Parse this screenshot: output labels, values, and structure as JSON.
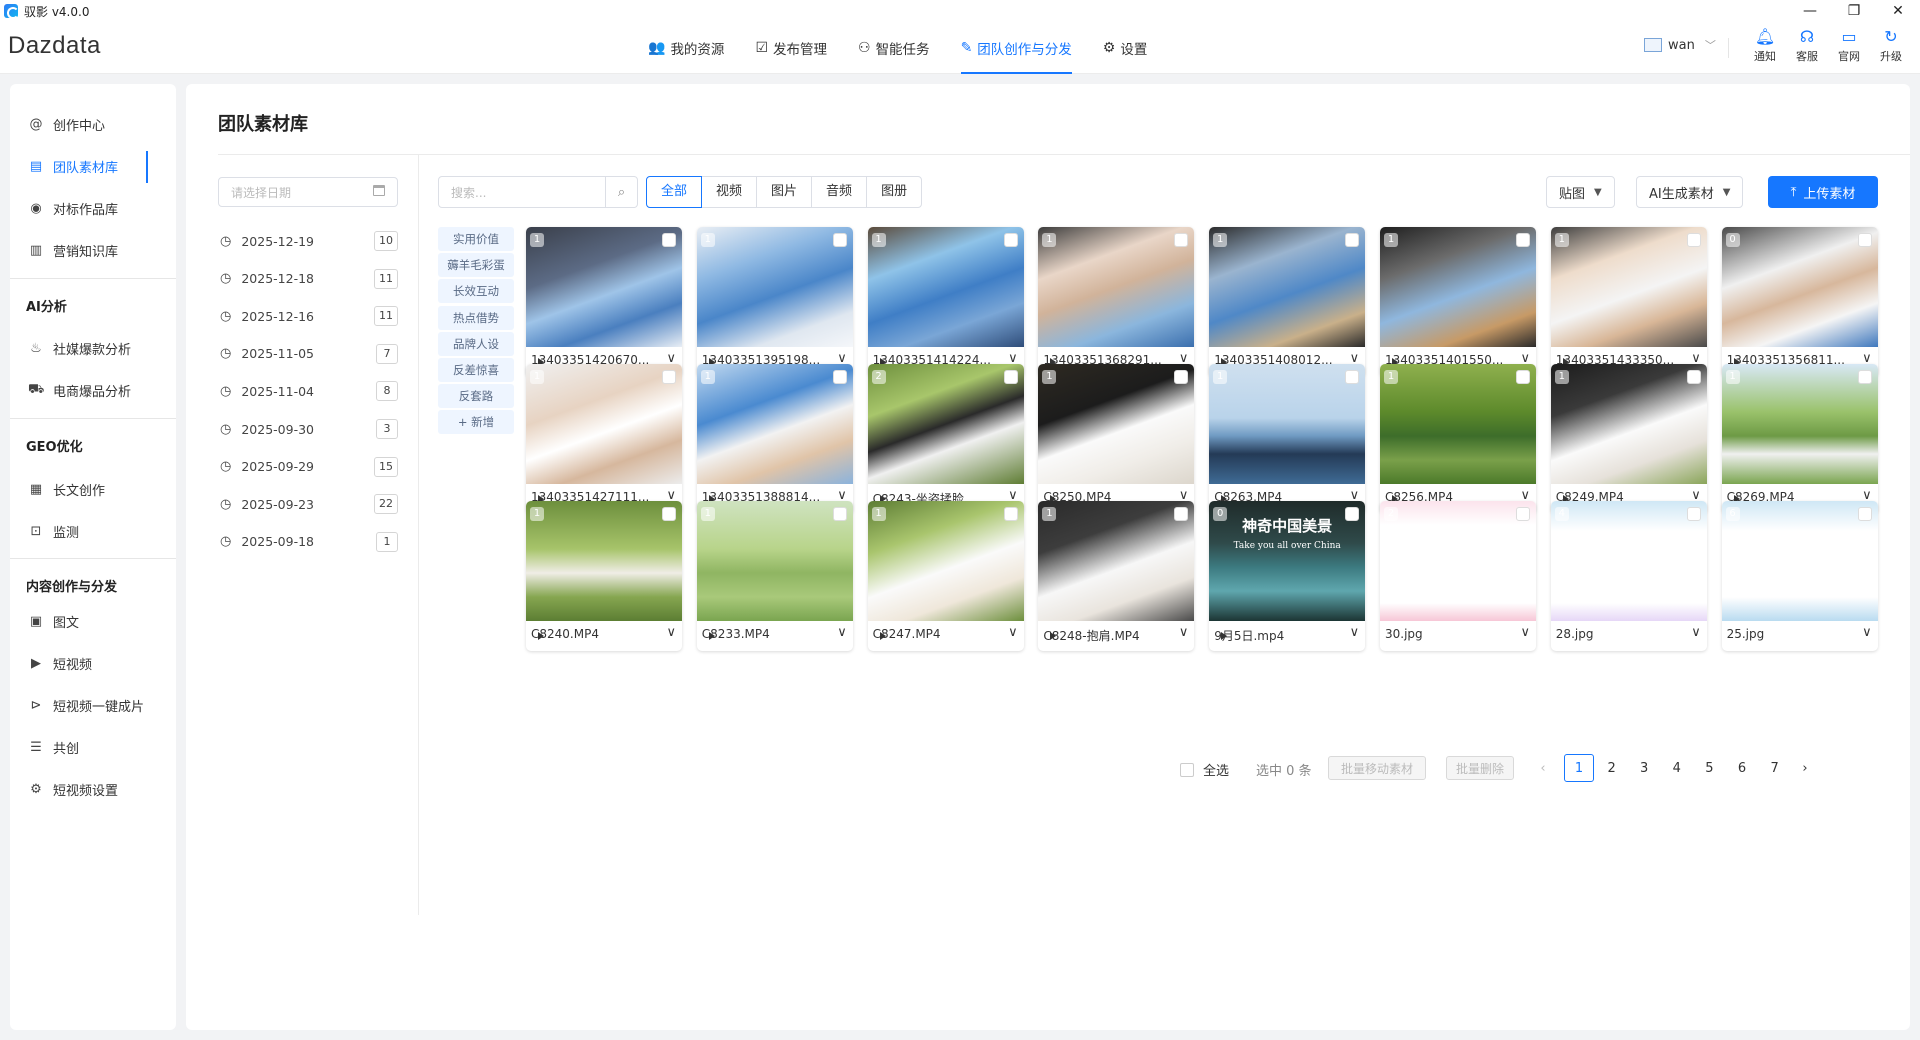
{
  "window": {
    "title": "驭影 v4.0.0",
    "controls": [
      "—",
      "❐",
      "✕"
    ]
  },
  "header": {
    "logo": "Dazdata",
    "nav": [
      {
        "label": "我的资源",
        "icon": "users-icon"
      },
      {
        "label": "发布管理",
        "icon": "publish-icon"
      },
      {
        "label": "智能任务",
        "icon": "task-icon"
      },
      {
        "label": "团队创作与分发",
        "icon": "team-create-icon",
        "active": true
      },
      {
        "label": "设置",
        "icon": "gear-icon"
      }
    ],
    "user": "wan",
    "tools": [
      {
        "label": "通知",
        "icon": "bell-icon"
      },
      {
        "label": "客服",
        "icon": "headset-icon"
      },
      {
        "label": "官网",
        "icon": "monitor-icon"
      },
      {
        "label": "升级",
        "icon": "refresh-icon"
      }
    ]
  },
  "sidebar": {
    "items_top": [
      {
        "label": "创作中心",
        "icon": "at-icon"
      },
      {
        "label": "团队素材库",
        "icon": "library-icon",
        "active": true
      },
      {
        "label": "对标作品库",
        "icon": "eye-icon"
      },
      {
        "label": "营销知识库",
        "icon": "barcode-icon"
      }
    ],
    "section_ai": {
      "title": "AI分析",
      "items": [
        {
          "label": "社媒爆款分析",
          "icon": "fire-icon"
        },
        {
          "label": "电商爆品分析",
          "icon": "cart-icon"
        }
      ]
    },
    "section_geo": {
      "title": "GEO优化",
      "items": [
        {
          "label": "长文创作",
          "icon": "book-icon"
        },
        {
          "label": "监测",
          "icon": "monitor-chart-icon"
        }
      ]
    },
    "section_content": {
      "title": "内容创作与分发",
      "items": [
        {
          "label": "图文",
          "icon": "image-text-icon"
        },
        {
          "label": "短视频",
          "icon": "video-icon"
        },
        {
          "label": "短视频一键成片",
          "icon": "video-auto-icon"
        },
        {
          "label": "共创",
          "icon": "doc-icon"
        },
        {
          "label": "短视频设置",
          "icon": "settings-icon"
        }
      ]
    }
  },
  "main": {
    "title": "团队素材库",
    "date_placeholder": "请选择日期",
    "dates": [
      {
        "date": "2025-12-19",
        "count": "10"
      },
      {
        "date": "2025-12-18",
        "count": "11"
      },
      {
        "date": "2025-12-16",
        "count": "11"
      },
      {
        "date": "2025-11-05",
        "count": "7"
      },
      {
        "date": "2025-11-04",
        "count": "8"
      },
      {
        "date": "2025-09-30",
        "count": "3"
      },
      {
        "date": "2025-09-29",
        "count": "15"
      },
      {
        "date": "2025-09-23",
        "count": "22"
      },
      {
        "date": "2025-09-18",
        "count": "1"
      }
    ],
    "search_placeholder": "搜索...",
    "filter_tabs": [
      "全部",
      "视频",
      "图片",
      "音频",
      "图册"
    ],
    "active_filter": "全部",
    "dropdown_sticker": "贴图",
    "dropdown_ai": "AI生成素材",
    "upload_label": "上传素材",
    "tags": [
      "实用价值",
      "薅羊毛彩蛋",
      "长效互动",
      "热点借势",
      "品牌人设",
      "反差惊喜",
      "反套路",
      "+ 新增"
    ],
    "cards": [
      {
        "name": "13403351420670...",
        "num": "1",
        "video": true
      },
      {
        "name": "13403351395198...",
        "num": "1",
        "video": true
      },
      {
        "name": "13403351414224...",
        "num": "1",
        "video": true
      },
      {
        "name": "13403351368291...",
        "num": "1",
        "video": true
      },
      {
        "name": "13403351408012...",
        "num": "1",
        "video": true
      },
      {
        "name": "13403351401550...",
        "num": "1",
        "video": true
      },
      {
        "name": "13403351433350...",
        "num": "1",
        "video": true
      },
      {
        "name": "13403351356811...",
        "num": "0",
        "video": true
      },
      {
        "name": "13403351427111...",
        "num": "1",
        "video": true
      },
      {
        "name": "13403351388814...",
        "num": "1",
        "video": true
      },
      {
        "name": "C8243-坐姿揉脸...",
        "num": "2",
        "video": true
      },
      {
        "name": "C8250.MP4",
        "num": "1",
        "video": true
      },
      {
        "name": "C8263.MP4",
        "num": "1",
        "video": true
      },
      {
        "name": "C8256.MP4",
        "num": "1",
        "video": true
      },
      {
        "name": "C8249.MP4",
        "num": "1",
        "video": true
      },
      {
        "name": "C8269.MP4",
        "num": "1",
        "video": true
      },
      {
        "name": "C8240.MP4",
        "num": "1",
        "video": true
      },
      {
        "name": "C8233.MP4",
        "num": "1",
        "video": true
      },
      {
        "name": "C8247.MP4",
        "num": "1",
        "video": true
      },
      {
        "name": "C8248-抱肩.MP4",
        "num": "1",
        "video": true
      },
      {
        "name": "9月5日.mp4",
        "num": "0",
        "video": true,
        "overlay_title": "神奇中国美景",
        "overlay_sub": "Take you all over China"
      },
      {
        "name": "30.jpg",
        "num": "2",
        "video": false
      },
      {
        "name": "28.jpg",
        "num": "4",
        "video": false
      },
      {
        "name": "25.jpg",
        "num": "6",
        "video": false
      }
    ],
    "select_all": "全选",
    "selected_count": "选中 0 条",
    "batch_move": "批量移动素材",
    "batch_delete": "批量删除",
    "pages": [
      "1",
      "2",
      "3",
      "4",
      "5",
      "6",
      "7"
    ],
    "current_page": "1"
  },
  "colors": {
    "accent": "#1677ff",
    "tag_bg": "#eef5ff",
    "background": "#f2f3f5"
  }
}
